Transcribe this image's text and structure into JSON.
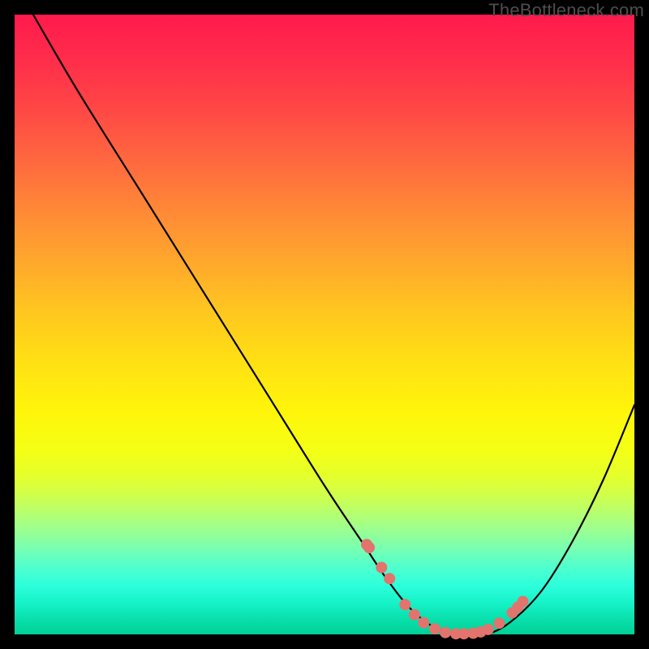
{
  "watermark": "TheBottleneck.com",
  "chart_data": {
    "type": "line",
    "title": "",
    "xlabel": "",
    "ylabel": "",
    "xlim": [
      0,
      100
    ],
    "ylim": [
      0,
      100
    ],
    "curve": {
      "x": [
        3,
        10,
        20,
        30,
        40,
        50,
        56,
        60,
        64,
        68,
        72,
        76,
        80,
        85,
        90,
        95,
        100
      ],
      "y": [
        100,
        88,
        72,
        56,
        40,
        24,
        15,
        9,
        4,
        1,
        0,
        0,
        2,
        7,
        15,
        25,
        37
      ]
    },
    "series": [
      {
        "name": "markers",
        "type": "scatter",
        "color": "#e2736d",
        "x": [
          56.8,
          57.2,
          59.2,
          60.5,
          63.0,
          64.5,
          66.0,
          67.8,
          69.5,
          71.2,
          72.5,
          74.0,
          75.2,
          76.4,
          78.2,
          80.3,
          81.2,
          82.0
        ],
        "y": [
          14.5,
          14.0,
          10.8,
          9.0,
          4.8,
          3.2,
          1.9,
          0.9,
          0.3,
          0.1,
          0.1,
          0.2,
          0.4,
          0.8,
          1.8,
          3.5,
          4.4,
          5.3
        ]
      }
    ],
    "background_gradient": {
      "top": "#ff1a4d",
      "mid": "#ffe014",
      "bottom": "#00cf94"
    }
  }
}
